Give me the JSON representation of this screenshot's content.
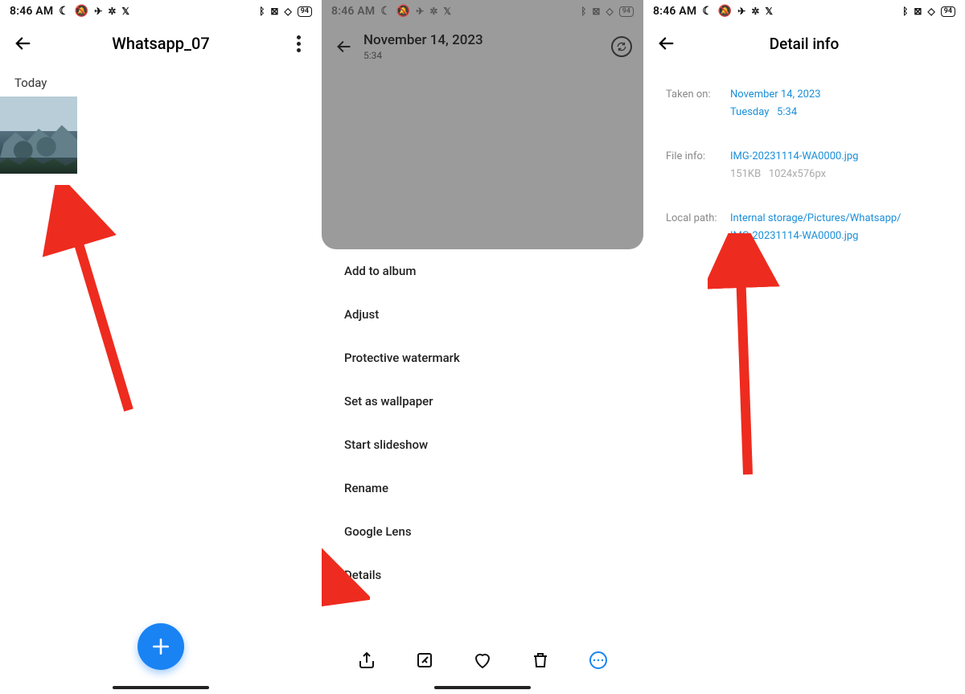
{
  "status": {
    "time": "8:46 AM",
    "battery": "94"
  },
  "panel1": {
    "title": "Whatsapp_07",
    "section": "Today"
  },
  "panel2": {
    "date": "November 14, 2023",
    "time": "5:34",
    "menu": [
      "Add to album",
      "Adjust",
      "Protective watermark",
      "Set as wallpaper",
      "Start slideshow",
      "Rename",
      "Google Lens",
      "Details"
    ]
  },
  "panel3": {
    "title": "Detail info",
    "taken_label": "Taken on:",
    "taken_date": "November 14, 2023",
    "taken_daytime": "Tuesday   5:34",
    "file_label": "File info:",
    "file_name": "IMG-20231114-WA0000.jpg",
    "file_meta": "151KB   1024x576px",
    "path_label": "Local path:",
    "path_value1": "Internal storage/Pictures/Whatsapp/",
    "path_value2": "IMG-20231114-WA0000.jpg"
  }
}
